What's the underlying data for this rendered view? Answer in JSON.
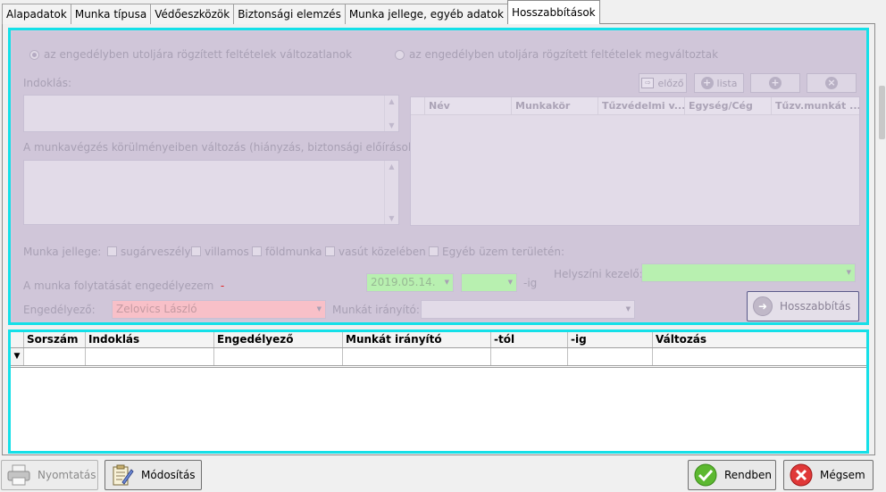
{
  "tabs": [
    "Alapadatok",
    "Munka típusa",
    "Védőeszközök",
    "Biztonsági elemzés",
    "Munka jellege, egyéb adatok",
    "Hosszabbítások"
  ],
  "radios": {
    "unchanged": "az engedélyben utoljára rögzített feltételek változatlanok",
    "changed": "az engedélyben utoljára rögzített feltételek megváltoztak"
  },
  "labels": {
    "indoklas": "Indoklás:",
    "valtozas": "A munkavégzés körülményeiben változás (hiányzás, biztonsági előírások):",
    "munka_jellege": "Munka jellege:",
    "folytatas": "A munka folytatását engedélyezem",
    "star": "-",
    "ig": "-ig",
    "helyszini": "Helyszíni kezelő:",
    "engedelyezo": "Engedélyező:",
    "iranyito": "Munkát irányító:"
  },
  "grid_buttons": {
    "elozo": "előző",
    "lista": "lista"
  },
  "person_grid_headers": [
    "Név",
    "Munkakör",
    "Tűzvédelmi v....",
    "Egység/Cég",
    "Tűzv.munkát ..."
  ],
  "work_types": [
    "sugárveszély",
    "villamos",
    "földmunka",
    "vasút közelében",
    "Egyéb üzem területén:"
  ],
  "fields": {
    "date": "2019.05.14.",
    "engedelyezo_value": "Zelovics László"
  },
  "hosszabbitas_button": "Hosszabbítás",
  "table_headers": [
    "Sorszám",
    "Indoklás",
    "Engedélyező",
    "Munkát irányító",
    "-tól",
    "-ig",
    "Változás"
  ],
  "bottom_buttons": {
    "print": "Nyomtatás",
    "modify": "Módosítás",
    "ok": "Rendben",
    "cancel": "Mégsem"
  },
  "colors": {
    "accent_border": "#14e0e8",
    "panel_bg": "#d0c6d9",
    "date_field": "#b8f0b0",
    "engedelyezo_field": "#f8c0c8"
  }
}
